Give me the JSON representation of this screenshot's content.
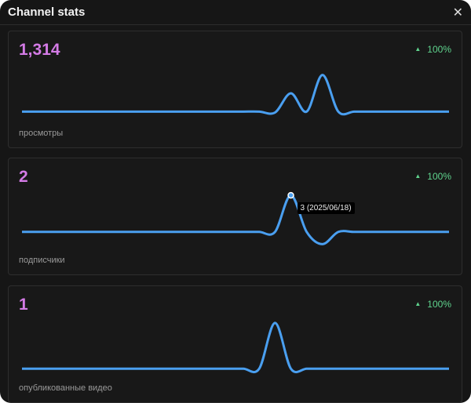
{
  "window": {
    "title": "Channel stats",
    "close_label": "✕"
  },
  "colors": {
    "number": "#d47be6",
    "delta": "#5fd38d",
    "line": "#4a9ff0"
  },
  "cards": [
    {
      "value": "1,314",
      "delta": "100%",
      "label": "просмотры",
      "series": [
        0,
        0,
        0,
        0,
        0,
        0,
        0,
        0,
        0,
        0,
        0,
        0,
        0,
        0,
        0,
        0,
        -0.05,
        1,
        0,
        2,
        0,
        0,
        0,
        0,
        0,
        0,
        0,
        0
      ],
      "ylim": [
        -0.5,
        2.5
      ]
    },
    {
      "value": "2",
      "delta": "100%",
      "label": "подписчики",
      "series": [
        0,
        0,
        0,
        0,
        0,
        0,
        0,
        0,
        0,
        0,
        0,
        0,
        0,
        0,
        0,
        0,
        0,
        3,
        0,
        -1,
        0,
        0,
        0,
        0,
        0,
        0,
        0,
        0
      ],
      "ylim": [
        -1.3,
        3.2
      ],
      "tooltip": {
        "index": 17,
        "text": "3 (2025/06/18)"
      }
    },
    {
      "value": "1",
      "delta": "100%",
      "label": "опубликованные видео",
      "series": [
        0,
        0,
        0,
        0,
        0,
        0,
        0,
        0,
        0,
        0,
        0,
        0,
        0,
        0,
        0,
        0,
        1,
        0,
        0,
        0,
        0,
        0,
        0,
        0,
        0,
        0,
        0,
        0
      ],
      "ylim": [
        -0.15,
        1.05
      ]
    }
  ]
}
